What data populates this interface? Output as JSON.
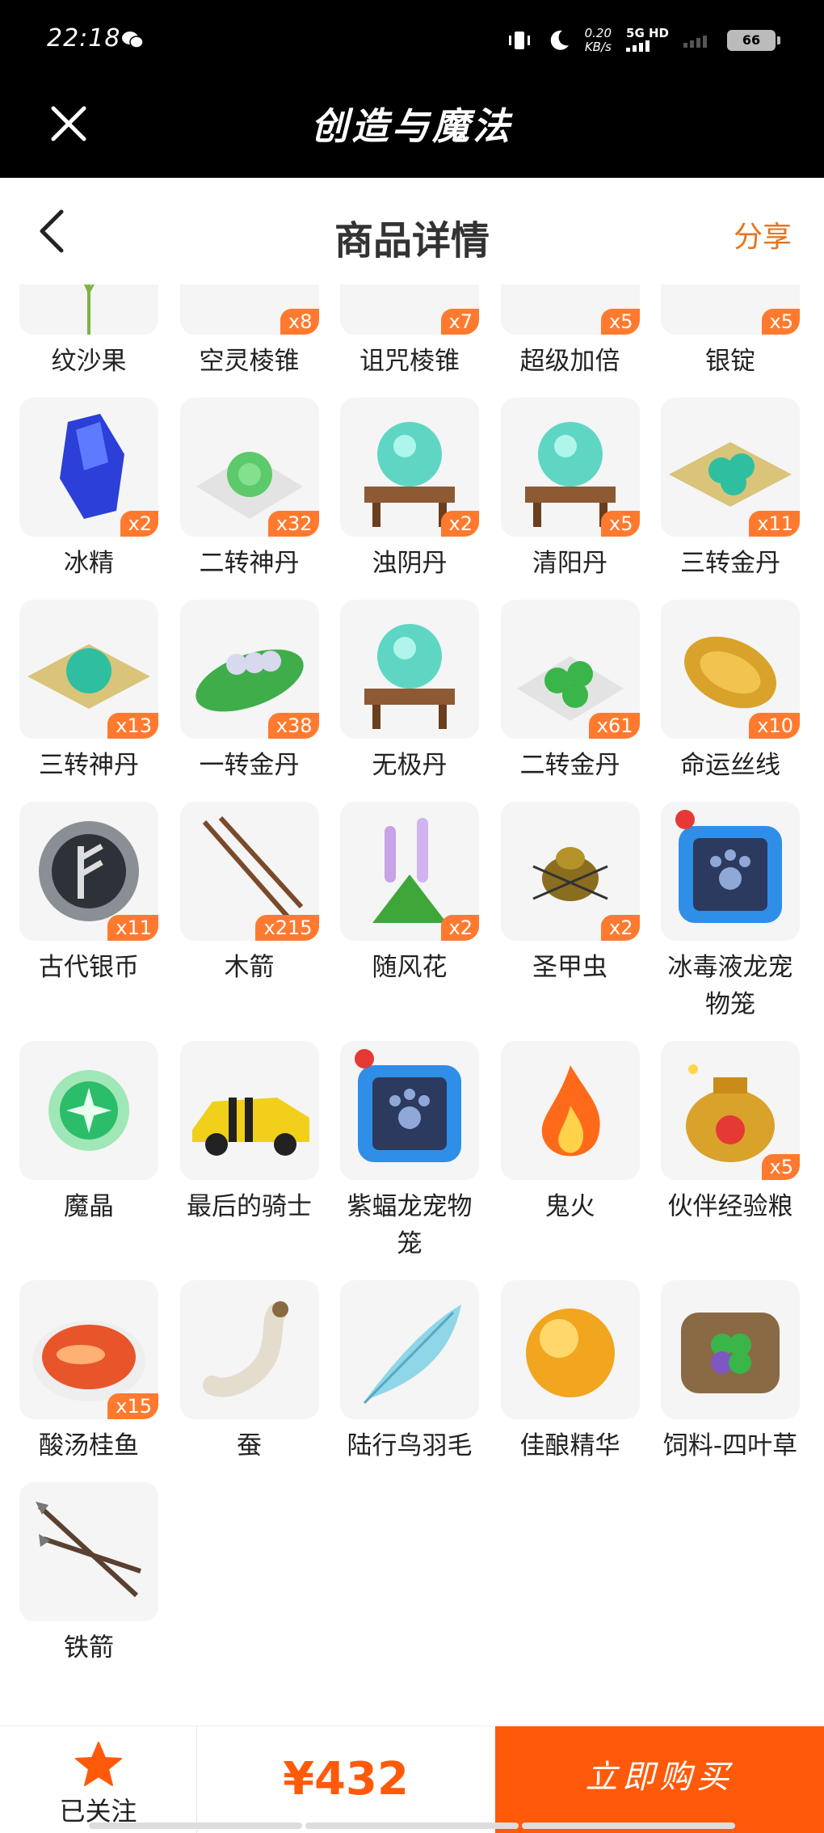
{
  "status_bar": {
    "time": "22:18",
    "net_speed_value": "0.20",
    "net_speed_unit": "KB/s",
    "network": "5G HD",
    "battery": "66"
  },
  "app_bar": {
    "title": "创造与魔法"
  },
  "nav_bar": {
    "title": "商品详情",
    "share_label": "分享"
  },
  "items": [
    {
      "name": "纹沙果",
      "qty": "",
      "icon": "plant-icon"
    },
    {
      "name": "空灵棱锥",
      "qty": "x8",
      "icon": "white-pyramid-icon"
    },
    {
      "name": "诅咒棱锥",
      "qty": "x7",
      "icon": "purple-pyramid-icon"
    },
    {
      "name": "超级加倍",
      "qty": "x5",
      "icon": "crystal-box-icon"
    },
    {
      "name": "银锭",
      "qty": "x5",
      "icon": "silver-ingot-icon"
    },
    {
      "name": "冰精",
      "qty": "x2",
      "icon": "blue-crystal-icon"
    },
    {
      "name": "二转神丹",
      "qty": "x32",
      "icon": "green-pill-icon"
    },
    {
      "name": "浊阴丹",
      "qty": "x2",
      "icon": "crystal-ball-stand-icon"
    },
    {
      "name": "清阳丹",
      "qty": "x5",
      "icon": "crystal-ball-stand-icon"
    },
    {
      "name": "三转金丹",
      "qty": "x11",
      "icon": "pills-on-cloth-icon"
    },
    {
      "name": "三转神丹",
      "qty": "x13",
      "icon": "pill-on-cloth-icon"
    },
    {
      "name": "一转金丹",
      "qty": "x38",
      "icon": "pills-on-leaf-icon"
    },
    {
      "name": "无极丹",
      "qty": "",
      "icon": "crystal-ball-stand-icon"
    },
    {
      "name": "二转金丹",
      "qty": "x61",
      "icon": "green-pills-icon"
    },
    {
      "name": "命运丝线",
      "qty": "x10",
      "icon": "golden-thread-icon"
    },
    {
      "name": "古代银币",
      "qty": "x11",
      "icon": "rune-coin-icon"
    },
    {
      "name": "木箭",
      "qty": "x215",
      "icon": "wooden-arrows-icon"
    },
    {
      "name": "随风花",
      "qty": "x2",
      "icon": "lavender-flower-icon"
    },
    {
      "name": "圣甲虫",
      "qty": "x2",
      "icon": "scarab-icon"
    },
    {
      "name": "冰毒液龙宠物笼",
      "qty": "",
      "icon": "pet-cage-icon"
    },
    {
      "name": "魔晶",
      "qty": "",
      "icon": "magic-crystal-icon"
    },
    {
      "name": "最后的骑士",
      "qty": "",
      "icon": "yellow-car-icon"
    },
    {
      "name": "紫蝠龙宠物笼",
      "qty": "",
      "icon": "pet-cage-icon"
    },
    {
      "name": "鬼火",
      "qty": "",
      "icon": "fire-icon"
    },
    {
      "name": "伙伴经验粮",
      "qty": "x5",
      "icon": "food-bag-icon"
    },
    {
      "name": "酸汤桂鱼",
      "qty": "x15",
      "icon": "fish-dish-icon"
    },
    {
      "name": "蚕",
      "qty": "",
      "icon": "silkworm-icon"
    },
    {
      "name": "陆行鸟羽毛",
      "qty": "",
      "icon": "feather-icon"
    },
    {
      "name": "佳酿精华",
      "qty": "",
      "icon": "golden-orb-icon"
    },
    {
      "name": "饲料-四叶草",
      "qty": "",
      "icon": "clover-sack-icon"
    },
    {
      "name": "铁箭",
      "qty": "",
      "icon": "iron-arrows-icon"
    }
  ],
  "bottom_bar": {
    "follow_label": "已关注",
    "price": "¥432",
    "buy_label": "立即购买"
  },
  "colors": {
    "accent": "#ff5a0a",
    "share": "#e8731a",
    "badge": "#ff7a2e"
  }
}
